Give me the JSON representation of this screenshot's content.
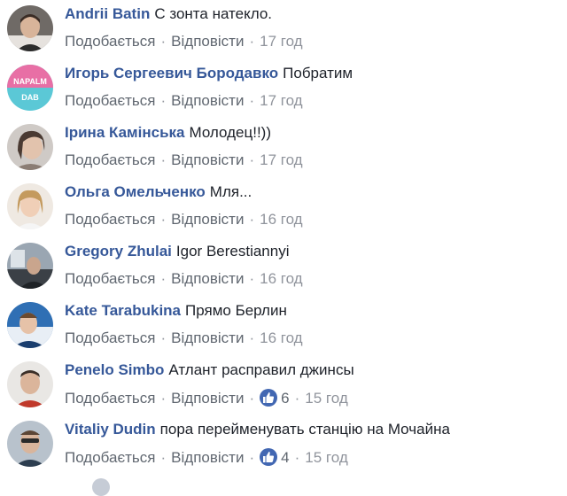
{
  "actions": {
    "like_label": "Подобається",
    "reply_label": "Відповісти",
    "separator": "·"
  },
  "comments": [
    {
      "author": "Andrii Batin",
      "text": "С зонта натекло.",
      "time": "17 год"
    },
    {
      "author": "Игорь Сергеевич Бородавко",
      "text": "Побратим",
      "time": "17 год"
    },
    {
      "author": "Ірина Камінська",
      "text": "Молодец!!))",
      "time": "17 год"
    },
    {
      "author": "Ольга Омельченко",
      "text": "Мля...",
      "time": "16 год"
    },
    {
      "author": "Gregory Zhulai",
      "text": "Igor Berestiannyi",
      "time": "16 год"
    },
    {
      "author": "Kate Tarabukina",
      "text": "Прямо Берлин",
      "time": "16 год"
    },
    {
      "author": "Penelo Simbo",
      "text": "Атлант расправил джинсы",
      "reactions": "6",
      "time": "15 год"
    },
    {
      "author": "Vitaliy Dudin",
      "text": "пора перейменувать станцію на Мочайна",
      "reactions": "4",
      "time": "15 год"
    }
  ],
  "avatar_texts": {
    "napalm_line1": "NAPALM",
    "napalm_line2": "DAB"
  },
  "colors": {
    "author": "#365899",
    "meta": "#90949c",
    "like_badge": "#4267b2"
  }
}
